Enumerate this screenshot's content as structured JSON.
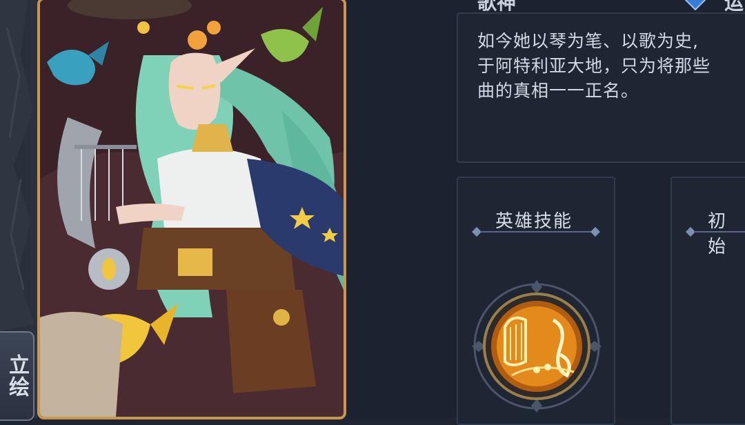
{
  "hero": {
    "name_fragment": "歌神",
    "tab_label": "立绘"
  },
  "top_right": {
    "word_fragment": "运",
    "gem_icon": "blue-diamond-icon"
  },
  "description": {
    "text": "如今她以琴为笔、以歌为史,\n于阿特利亚大地，只为将那些\n曲的真相一一正名。"
  },
  "sections": {
    "skill_label": "英雄技能",
    "initial_label": "初始"
  },
  "colors": {
    "frame_gold": "#c9974f",
    "panel_bg": "#1c2230",
    "accent_line": "#5a6a86"
  }
}
